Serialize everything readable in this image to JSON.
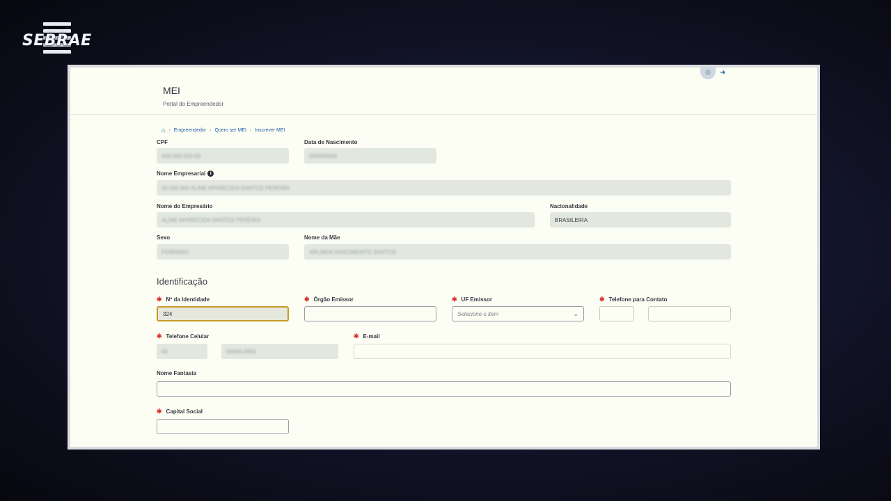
{
  "brand": {
    "logo_text": "SEBRAE"
  },
  "header": {
    "title": "MEI",
    "subtitle": "Portal do Empreendedor",
    "home_icon": "home-icon",
    "logout_icon": "logout-icon"
  },
  "breadcrumb": [
    "Empreendedor",
    "Quero ser MEI",
    "Inscrever MEI"
  ],
  "personal": {
    "cpf_label": "CPF",
    "cpf_value": "000.000.000-00",
    "birth_label": "Data de Nascimento",
    "birth_value": "00/00/0000",
    "company_label": "Nome Empresarial",
    "company_value": "00.000.000 ALINE APARECIDA SANTOS PEREIRA",
    "owner_label": "Nome do Empresário",
    "owner_value": "ALINE APARECIDA SANTOS PEREIRA",
    "nationality_label": "Nacionalidade",
    "nationality_value": "BRASILEIRA",
    "sex_label": "Sexo",
    "sex_value": "FEMININO",
    "mother_label": "Nome da Mãe",
    "mother_value": "ARLINDA NASCIMENTO SANTOS"
  },
  "identification": {
    "section_title": "Identificação",
    "id_number_label": "Nº da Identidade",
    "id_number_value": "324",
    "issuer_label": "Órgão Emissor",
    "issuer_value": "",
    "uf_label": "UF Emissor",
    "uf_placeholder": "Selecione o item",
    "contact_phone_label": "Telefone para Contato",
    "mobile_label": "Telefone Celular",
    "mobile_ddd": "00",
    "mobile_number": "00000-0000",
    "email_label": "E-mail",
    "trade_name_label": "Nome Fantasia",
    "capital_label": "Capital Social"
  }
}
